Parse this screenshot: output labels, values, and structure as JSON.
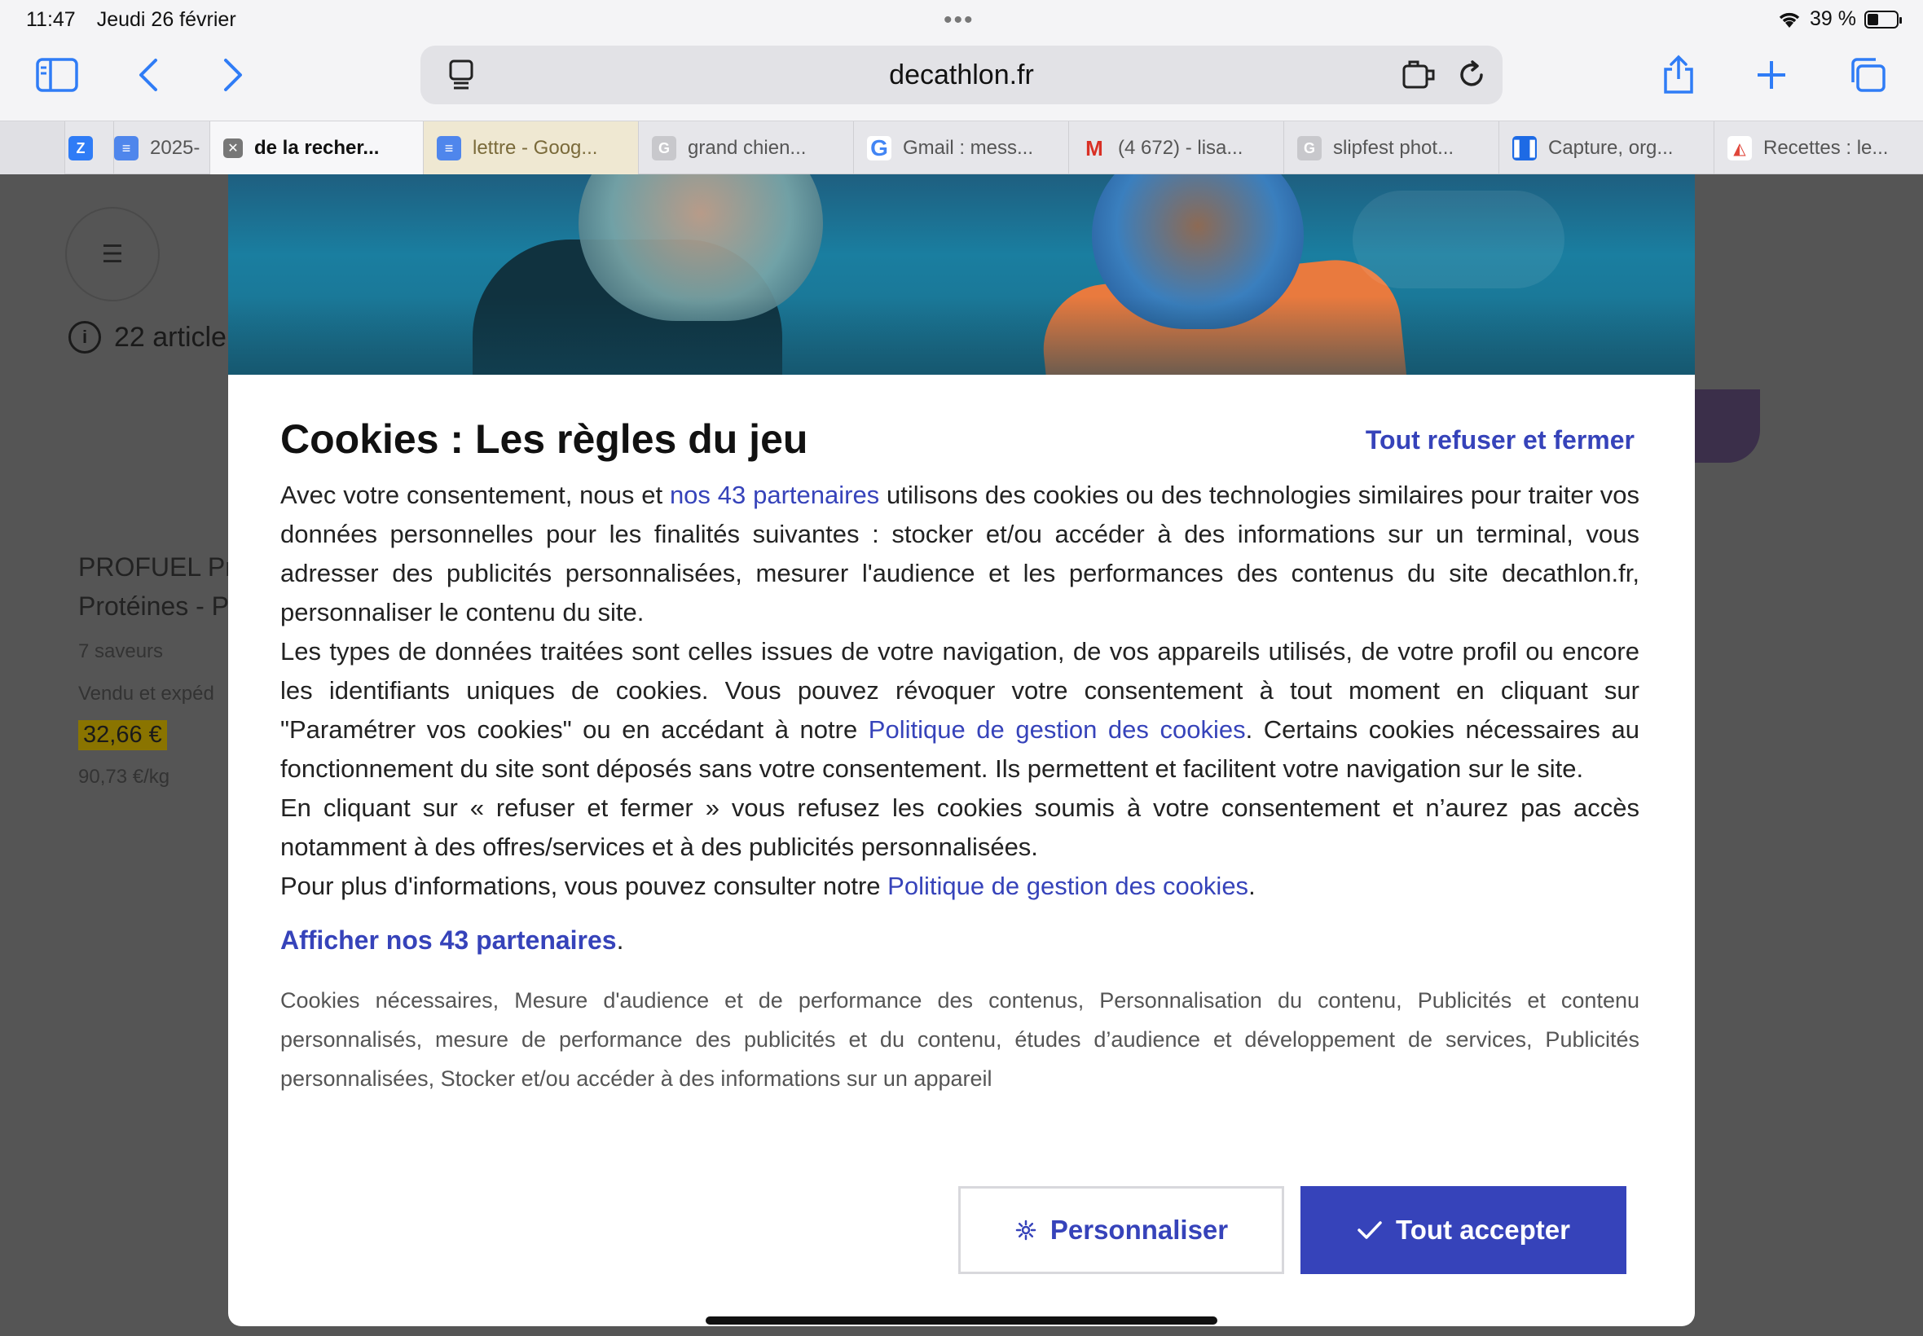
{
  "status_bar": {
    "time": "11:47",
    "date": "Jeudi 26 février",
    "battery": "39 %",
    "battery_level": 0.39
  },
  "url_bar": {
    "url": "decathlon.fr"
  },
  "tabs": [
    {
      "label": "",
      "icon": "zoho-z-icon"
    },
    {
      "label": "2025-",
      "icon": "google-docs-icon"
    },
    {
      "label": "de la recher...",
      "icon": "close-icon",
      "active": true
    },
    {
      "label": "lettre - Goog...",
      "icon": "google-docs-icon"
    },
    {
      "label": "grand chien...",
      "icon": "generic-g-icon"
    },
    {
      "label": "Gmail : mess...",
      "icon": "google-g-icon"
    },
    {
      "label": "(4 672) - lisa...",
      "icon": "gmail-m-icon"
    },
    {
      "label": "slipfest phot...",
      "icon": "generic-g-icon"
    },
    {
      "label": "Capture, org...",
      "icon": "trello-icon"
    },
    {
      "label": "Recettes : le...",
      "icon": "recipe-icon"
    }
  ],
  "background_page": {
    "articles": "22 article",
    "product_name": "PROFUEL Pr Protéines - P",
    "flavors": "7 saveurs",
    "sold_by": "Vendu et expéd",
    "price": "32,66 €",
    "price_per_kg": "90,73 €/kg"
  },
  "modal": {
    "title": "Cookies : Les règles du jeu",
    "refuse_label": "Tout refuser et fermer",
    "p1_a": "Avec votre consentement, nous et ",
    "p1_link": "nos 43 partenaires",
    "p1_b": " utilisons des cookies ou des technologies similaires pour traiter vos données personnelles pour les finalités suivantes : stocker et/ou accéder à des informations sur un terminal, vous adresser des publicités personnalisées, mesurer l'audience et les performances des contenus du site decathlon.fr, personnaliser le contenu du site.",
    "p2_a": "Les types de données traitées sont celles issues de votre navigation, de vos appareils utilisés, de votre profil ou encore les identifiants uniques de cookies. Vous pouvez révoquer votre consentement à tout moment en cliquant sur \"Paramétrer vos cookies\" ou en accédant à notre ",
    "p2_link": "Politique de gestion des cookies",
    "p2_b": ". Certains cookies nécessaires au fonctionnement du site sont déposés sans votre consentement. Ils permettent et facilitent votre navigation sur le site.",
    "p3": "En cliquant sur « refuser et fermer » vous refusez les cookies soumis à votre consentement et n’aurez pas accès notamment à des offres/services et à des publicités personnalisées.",
    "p4_a": "Pour plus d'informations, vous pouvez consulter notre ",
    "p4_link": "Politique de gestion des cookies",
    "p4_b": ".",
    "partners_link": "Afficher nos 43 partenaires",
    "partners_after": ".",
    "purposes": "Cookies nécessaires, Mesure d'audience et de performance des contenus, Personnalisation du contenu, Publicités et contenu personnalisés, mesure de performance des publicités et du contenu, études d’audience et développement de services, Publicités personnalisées, Stocker et/ou accéder à des informations sur un appareil",
    "customize_label": "Personnaliser",
    "accept_label": "Tout accepter"
  },
  "colors": {
    "accent": "#3643ba",
    "safari_blue": "#2f7cf6"
  }
}
